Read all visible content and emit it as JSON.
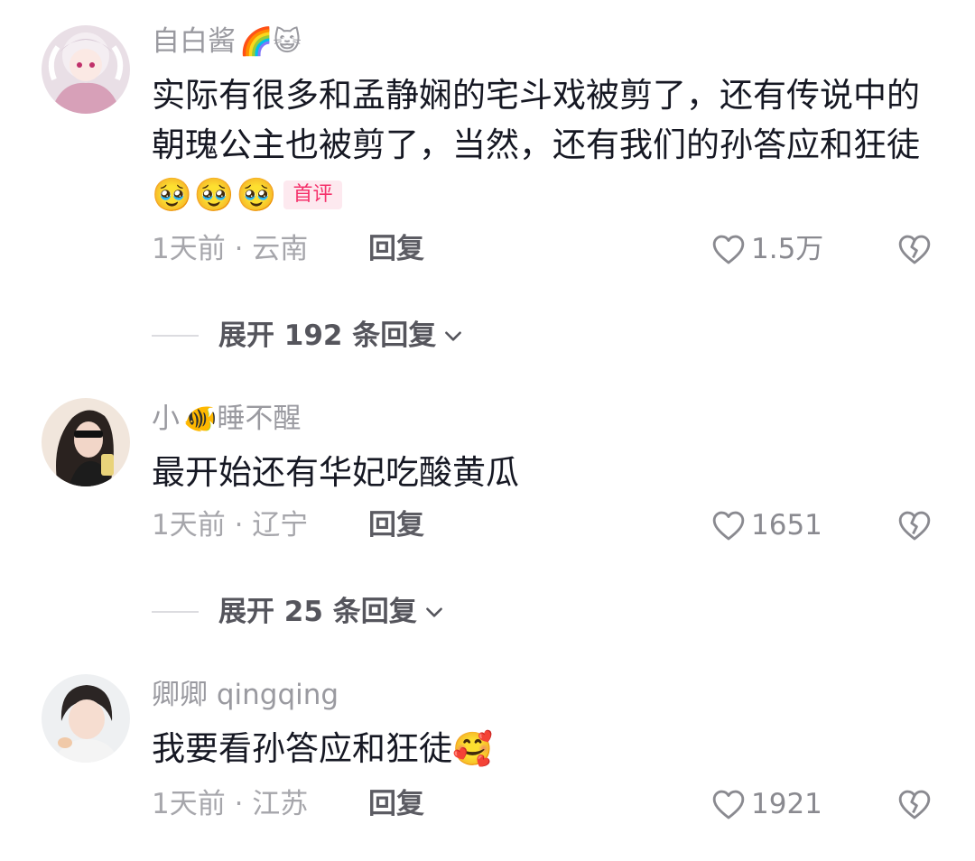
{
  "comments": [
    {
      "username": "自白酱",
      "username_emoji": "🌈😺",
      "text": "实际有很多和孟静娴的宅斗戏被剪了，还有传说中的朝瑰公主也被剪了，当然，还有我们的孙答应和狂徒",
      "text_emoji": "🥹🥹🥹",
      "badge": "首评",
      "meta": "1天前 · 云南",
      "reply_label": "回复",
      "like_count": "1.5万",
      "expand_label": "展开 192 条回复"
    },
    {
      "username_prefix": "小",
      "username_emoji": "🐠",
      "username": "睡不醒",
      "text": "最开始还有华妃吃酸黄瓜",
      "meta": "1天前 · 辽宁",
      "reply_label": "回复",
      "like_count": "1651",
      "expand_label": "展开 25 条回复"
    },
    {
      "username": "卿卿 qingqing",
      "text": "我要看孙答应和狂徒",
      "text_emoji": "🥰",
      "meta": "1天前 · 江苏",
      "reply_label": "回复",
      "like_count": "1921"
    }
  ],
  "icons": {
    "like": "heart-outline-icon",
    "dislike": "broken-heart-icon",
    "expand": "chevron-down-icon"
  },
  "colors": {
    "badge_text": "#f5316b",
    "badge_bg": "#fde9ef",
    "meta": "#a6a6ab",
    "text": "#161823"
  }
}
